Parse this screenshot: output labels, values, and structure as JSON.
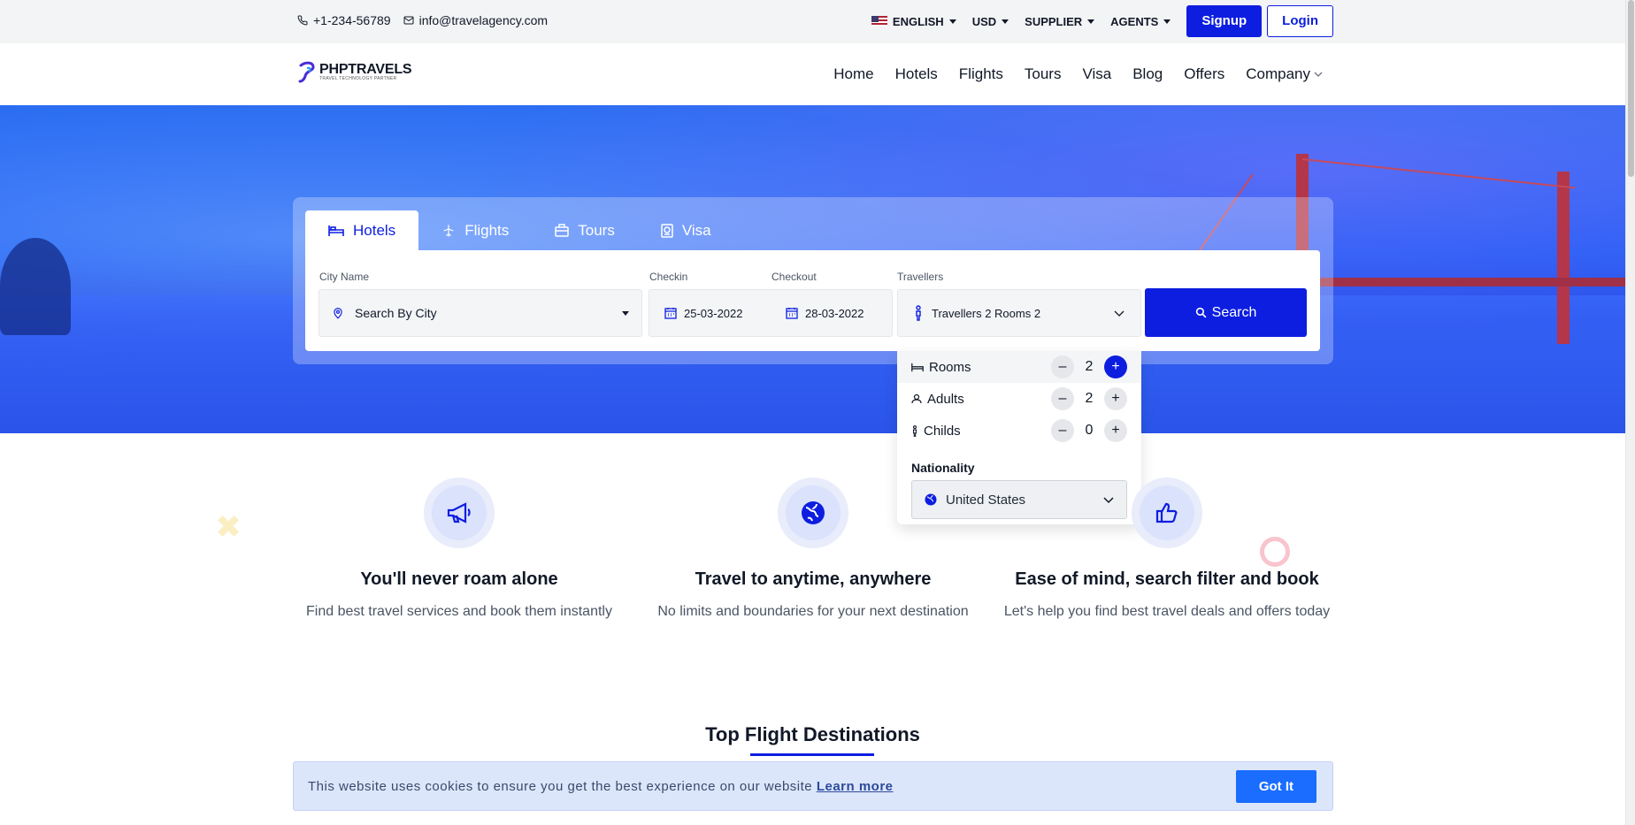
{
  "topbar": {
    "phone": "+1-234-56789",
    "email": "info@travelagency.com",
    "language": "ENGLISH",
    "currency": "USD",
    "supplier": "SUPPLIER",
    "agents": "AGENTS",
    "signup": "Signup",
    "login": "Login"
  },
  "header": {
    "logo_title": "PHPTRAVELS",
    "logo_tagline": "TRAVEL TECHNOLOGY PARTNER",
    "nav": [
      "Home",
      "Hotels",
      "Flights",
      "Tours",
      "Visa",
      "Blog",
      "Offers",
      "Company"
    ]
  },
  "search": {
    "tabs": [
      "Hotels",
      "Flights",
      "Tours",
      "Visa"
    ],
    "active_tab": "Hotels",
    "city_label": "City Name",
    "city_placeholder": "Search By City",
    "checkin_label": "Checkin",
    "checkin_value": "25-03-2022",
    "checkout_label": "Checkout",
    "checkout_value": "28-03-2022",
    "travellers_label": "Travellers",
    "travellers_value": "Travellers 2 Rooms 2",
    "search_button": "Search"
  },
  "travellers_dropdown": {
    "rooms_label": "Rooms",
    "rooms": "2",
    "adults_label": "Adults",
    "adults": "2",
    "childs_label": "Childs",
    "childs": "0",
    "nationality_label": "Nationality",
    "nationality": "United States"
  },
  "features": [
    {
      "icon": "megaphone-icon",
      "title": "You'll never roam alone",
      "text": "Find best travel services and book them instantly"
    },
    {
      "icon": "globe-icon",
      "title": "Travel to anytime, anywhere",
      "text": "No limits and boundaries for your next destination"
    },
    {
      "icon": "thumbs-up-icon",
      "title": "Ease of mind, search filter and book",
      "text": "Let's help you find best travel deals and offers today"
    }
  ],
  "section_title": "Top Flight Destinations",
  "cookie": {
    "text": "This website uses cookies to ensure you get the best experience on our website",
    "learn_more": "Learn more",
    "button": "Got It"
  },
  "colors": {
    "primary": "#0d1ee0",
    "cookie_button": "#1a6dff",
    "cookie_bg": "#dce6fb"
  }
}
